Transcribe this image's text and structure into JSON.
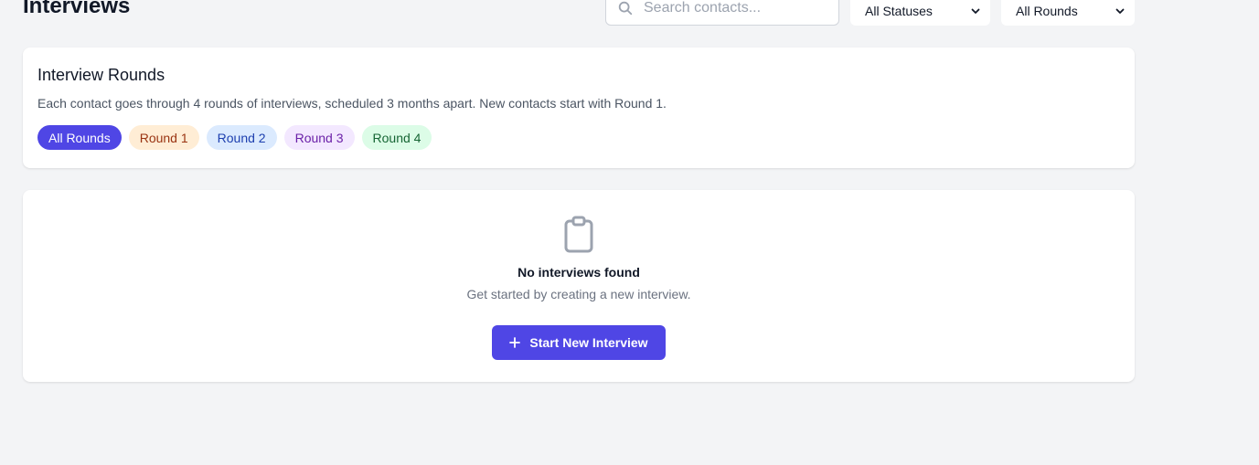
{
  "header": {
    "title": "Interviews",
    "search_placeholder": "Search contacts...",
    "status_filter": {
      "selected": "All Statuses"
    },
    "round_filter": {
      "selected": "All Rounds"
    }
  },
  "rounds_card": {
    "title": "Interview Rounds",
    "description": "Each contact goes through 4 rounds of interviews, scheduled 3 months apart. New contacts start with Round 1.",
    "chips": [
      {
        "label": "All Rounds"
      },
      {
        "label": "Round 1"
      },
      {
        "label": "Round 2"
      },
      {
        "label": "Round 3"
      },
      {
        "label": "Round 4"
      }
    ]
  },
  "empty_state": {
    "icon": "clipboard-icon",
    "title": "No interviews found",
    "subtitle": "Get started by creating a new interview.",
    "button_label": "Start New Interview"
  },
  "colors": {
    "primary": "#4f46e5",
    "background": "#f3f4f6"
  }
}
